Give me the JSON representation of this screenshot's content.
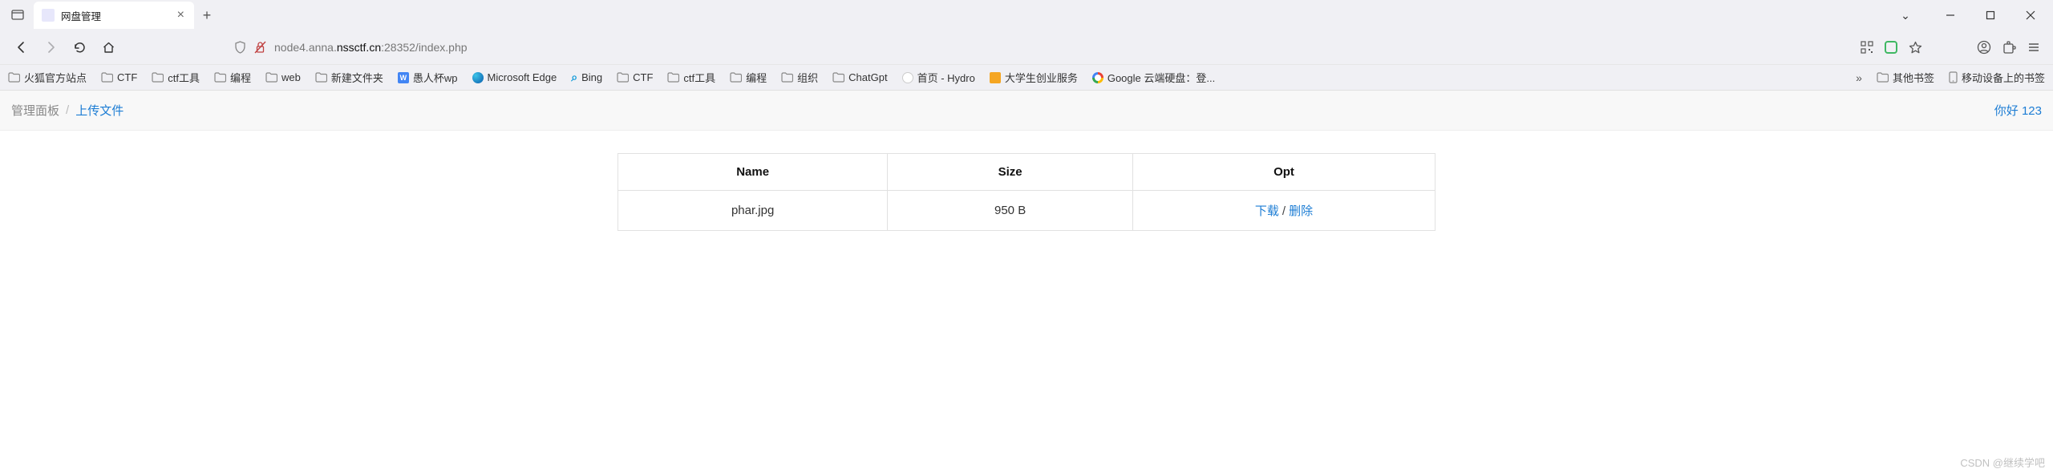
{
  "browser": {
    "tab_title": "网盘管理",
    "url": {
      "pre": "node4.anna.",
      "bold": "nssctf.cn",
      "post": ":28352/index.php"
    },
    "bookmarks": [
      {
        "icon": "folder",
        "label": "火狐官方站点"
      },
      {
        "icon": "folder",
        "label": "CTF"
      },
      {
        "icon": "folder",
        "label": "ctf工具"
      },
      {
        "icon": "folder",
        "label": "编程"
      },
      {
        "icon": "folder",
        "label": "web"
      },
      {
        "icon": "folder",
        "label": "新建文件夹"
      },
      {
        "icon": "wdoc",
        "label": "愚人杯wp"
      },
      {
        "icon": "edge",
        "label": "Microsoft Edge"
      },
      {
        "icon": "bing",
        "label": "Bing"
      },
      {
        "icon": "folder",
        "label": "CTF"
      },
      {
        "icon": "folder",
        "label": "ctf工具"
      },
      {
        "icon": "folder",
        "label": "编程"
      },
      {
        "icon": "folder",
        "label": "组织"
      },
      {
        "icon": "folder",
        "label": "ChatGpt"
      },
      {
        "icon": "hydro",
        "label": "首页 - Hydro"
      },
      {
        "icon": "yel",
        "label": "大学生创业服务"
      },
      {
        "icon": "goog",
        "label": "Google 云端硬盘：登..."
      }
    ],
    "bm_right": [
      {
        "icon": "folder",
        "label": "其他书签"
      },
      {
        "icon": "mobile",
        "label": "移动设备上的书签"
      }
    ]
  },
  "page": {
    "breadcrumb": {
      "root": "管理面板",
      "link": "上传文件"
    },
    "greeting": "你好 123",
    "table": {
      "headers": {
        "name": "Name",
        "size": "Size",
        "opt": "Opt"
      },
      "rows": [
        {
          "name": "phar.jpg",
          "size": "950 B",
          "download": "下载",
          "delete": "删除"
        }
      ]
    }
  },
  "watermark": "CSDN @继续学吧"
}
